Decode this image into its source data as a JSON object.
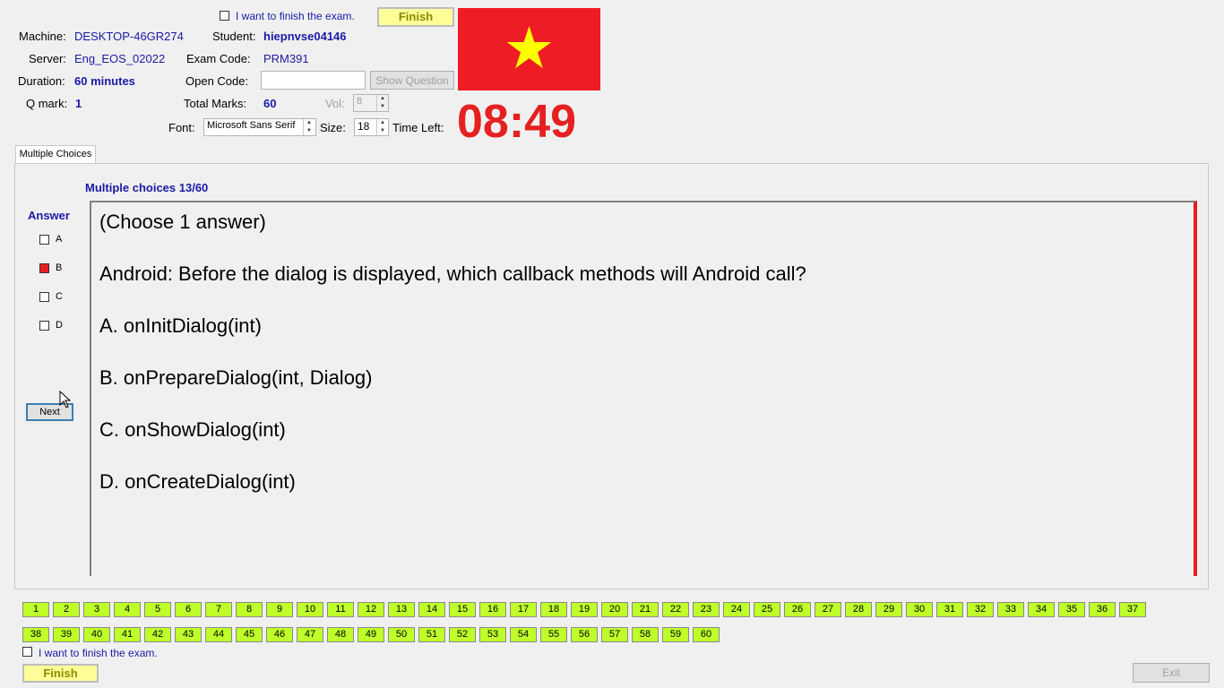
{
  "top": {
    "finish_checkbox_label": "I want to finish the exam.",
    "finish_button": "Finish",
    "machine_label": "Machine:",
    "machine_value": "DESKTOP-46GR274",
    "student_label": "Student:",
    "student_value": "hiepnvse04146",
    "server_label": "Server:",
    "server_value": "Eng_EOS_02022",
    "exam_code_label": "Exam Code:",
    "exam_code_value": "PRM391",
    "duration_label": "Duration:",
    "duration_value": "60 minutes",
    "open_code_label": "Open Code:",
    "open_code_value": "",
    "show_question_button": "Show Question",
    "qmark_label": "Q mark:",
    "qmark_value": "1",
    "total_marks_label": "Total Marks:",
    "total_marks_value": "60",
    "vol_label": "Vol:",
    "vol_value": "8",
    "font_label": "Font:",
    "font_value": "Microsoft Sans Serif",
    "size_label": "Size:",
    "size_value": "18",
    "time_left_label": "Time Left:",
    "time_left_value": "08:49"
  },
  "flag": {
    "bg_color": "#ee1c25",
    "star_color": "#ffff00"
  },
  "tab": {
    "label": "Multiple Choices"
  },
  "question": {
    "header": "Multiple choices 13/60",
    "answer_label": "Answer",
    "options": [
      {
        "letter": "A",
        "checked": false
      },
      {
        "letter": "B",
        "checked": true
      },
      {
        "letter": "C",
        "checked": false
      },
      {
        "letter": "D",
        "checked": false
      }
    ],
    "next_button": "Next",
    "lines": [
      "(Choose 1 answer)",
      "Android: Before the dialog is displayed, which callback methods will Android call?",
      "A.  onInitDialog(int)",
      "B.  onPrepareDialog(int, Dialog)",
      "C.  onShowDialog(int)",
      "D.  onCreateDialog(int)"
    ]
  },
  "nav": {
    "row1": [
      "1",
      "2",
      "3",
      "4",
      "5",
      "6",
      "7",
      "8",
      "9",
      "10",
      "11",
      "12",
      "13",
      "14",
      "15",
      "16",
      "17",
      "18",
      "19",
      "20",
      "21",
      "22",
      "23",
      "24",
      "25",
      "26",
      "27",
      "28",
      "29",
      "30",
      "31",
      "32",
      "33",
      "34",
      "35",
      "36",
      "37"
    ],
    "row2": [
      "38",
      "39",
      "40",
      "41",
      "42",
      "43",
      "44",
      "45",
      "46",
      "47",
      "48",
      "49",
      "50",
      "51",
      "52",
      "53",
      "54",
      "55",
      "56",
      "57",
      "58",
      "59",
      "60"
    ]
  },
  "bottom": {
    "finish_checkbox_label": "I want to finish the exam.",
    "finish_button": "Finish",
    "exit_button": "Exit"
  },
  "colors": {
    "accent_blue": "#1a1aa6",
    "timer_red": "#e62020",
    "nav_green": "#bfff2a",
    "finish_yellow": "#ffff99"
  }
}
